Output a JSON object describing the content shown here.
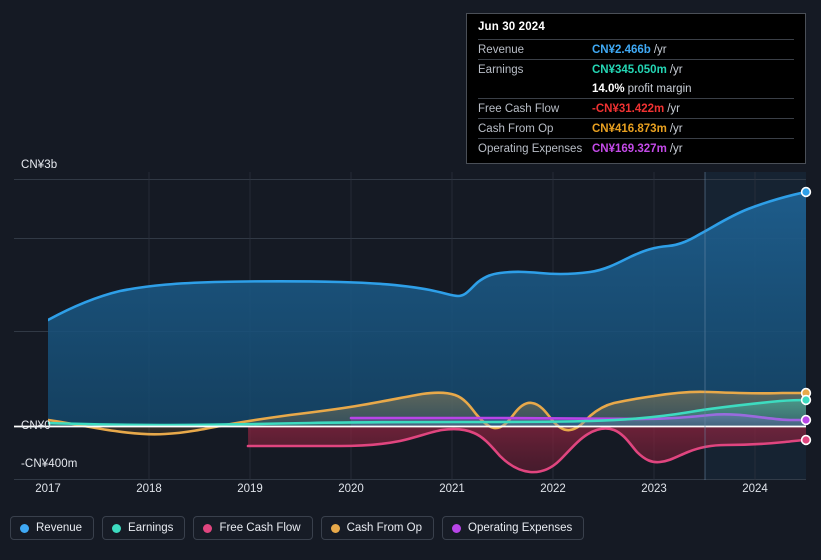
{
  "chart_data": {
    "type": "area",
    "title": "",
    "xlabel": "",
    "ylabel": "",
    "x_ticks": [
      "2017",
      "2018",
      "2019",
      "2020",
      "2021",
      "2022",
      "2023",
      "2024"
    ],
    "y_ticks": [
      "CN¥3b",
      "CN¥0",
      "-CN¥400m"
    ],
    "ylim": [
      -400000000,
      3000000000
    ],
    "currency": "CN¥",
    "grid": true,
    "legend_position": "bottom-left",
    "series": [
      {
        "name": "Revenue",
        "color": "#2e9fe8",
        "x": [
          2017.0,
          2017.5,
          2018.0,
          2018.5,
          2019.0,
          2019.5,
          2020.0,
          2020.5,
          2021.0,
          2021.3,
          2021.6,
          2021.8,
          2022.0,
          2022.3,
          2022.6,
          2023.0,
          2023.3,
          2023.6,
          2024.0,
          2024.5
        ],
        "values": [
          1220000000,
          1380000000,
          1470000000,
          1510000000,
          1530000000,
          1545000000,
          1555000000,
          1540000000,
          1500000000,
          1430000000,
          1400000000,
          1520000000,
          1560000000,
          1545000000,
          1580000000,
          1700000000,
          1790000000,
          1800000000,
          2080000000,
          2466000000
        ],
        "end_value_label": "CN¥2.466b"
      },
      {
        "name": "Earnings",
        "color": "#3ddbc0",
        "x": [
          2017.0,
          2018.0,
          2019.0,
          2020.0,
          2021.0,
          2022.0,
          2023.0,
          2024.0,
          2024.5
        ],
        "values": [
          20000000,
          10000000,
          5000000,
          20000000,
          30000000,
          20000000,
          60000000,
          220000000,
          345050000
        ],
        "end_value_label": "CN¥345.050m"
      },
      {
        "name": "Free Cash Flow",
        "color": "#e0457f",
        "x": [
          2019.0,
          2019.5,
          2020.0,
          2020.5,
          2021.0,
          2021.4,
          2021.8,
          2022.1,
          2022.4,
          2022.8,
          2023.1,
          2023.5,
          2024.0,
          2024.5
        ],
        "values": [
          -200000000,
          -200000000,
          -195000000,
          -130000000,
          -60000000,
          -30000000,
          -250000000,
          -440000000,
          -230000000,
          -40000000,
          -220000000,
          -300000000,
          -170000000,
          -31422000
        ],
        "end_value_label": "-CN¥31.422m"
      },
      {
        "name": "Cash From Op",
        "color": "#e8a94a",
        "x": [
          2017.0,
          2017.6,
          2018.2,
          2019.0,
          2019.8,
          2020.5,
          2021.0,
          2021.3,
          2021.6,
          2022.0,
          2022.3,
          2022.6,
          2022.9,
          2023.2,
          2023.6,
          2024.0,
          2024.5
        ],
        "values": [
          55000000,
          20000000,
          -40000000,
          20000000,
          75000000,
          120000000,
          200000000,
          250000000,
          150000000,
          30000000,
          150000000,
          20000000,
          80000000,
          130000000,
          250000000,
          400000000,
          416873000
        ],
        "end_value_label": "CN¥416.873m"
      },
      {
        "name": "Operating Expenses",
        "color": "#b845e8",
        "x": [
          2019.3,
          2020.0,
          2021.0,
          2022.0,
          2023.0,
          2023.6,
          2024.0,
          2024.5
        ],
        "values": [
          75000000,
          78000000,
          80000000,
          85000000,
          100000000,
          140000000,
          165000000,
          169327000
        ],
        "end_value_label": "CN¥169.327m"
      }
    ]
  },
  "tooltip": {
    "date": "Jun 30 2024",
    "rows": [
      {
        "key": "Revenue",
        "value": "CN¥2.466b",
        "unit": "/yr",
        "color": "#3fa9f5"
      },
      {
        "key": "Earnings",
        "value": "CN¥345.050m",
        "unit": "/yr",
        "color": "#24d6b4"
      },
      {
        "key": "",
        "value": "14.0%",
        "unit": "profit margin",
        "color": "#ffffff"
      },
      {
        "key": "Free Cash Flow",
        "value": "-CN¥31.422m",
        "unit": "/yr",
        "color": "#f03232"
      },
      {
        "key": "Cash From Op",
        "value": "CN¥416.873m",
        "unit": "/yr",
        "color": "#e8a020"
      },
      {
        "key": "Operating Expenses",
        "value": "CN¥169.327m",
        "unit": "/yr",
        "color": "#c44ae8"
      }
    ]
  },
  "axis": {
    "y_top_label": "CN¥3b",
    "y_zero_label": "CN¥0",
    "y_bottom_label": "-CN¥400m",
    "x_labels": [
      "2017",
      "2018",
      "2019",
      "2020",
      "2021",
      "2022",
      "2023",
      "2024"
    ]
  },
  "legend": {
    "items": [
      {
        "label": "Revenue",
        "color": "#3fa9f5"
      },
      {
        "label": "Earnings",
        "color": "#3ddbc0"
      },
      {
        "label": "Free Cash Flow",
        "color": "#e0457f"
      },
      {
        "label": "Cash From Op",
        "color": "#e8a94a"
      },
      {
        "label": "Operating Expenses",
        "color": "#b845e8"
      }
    ]
  }
}
